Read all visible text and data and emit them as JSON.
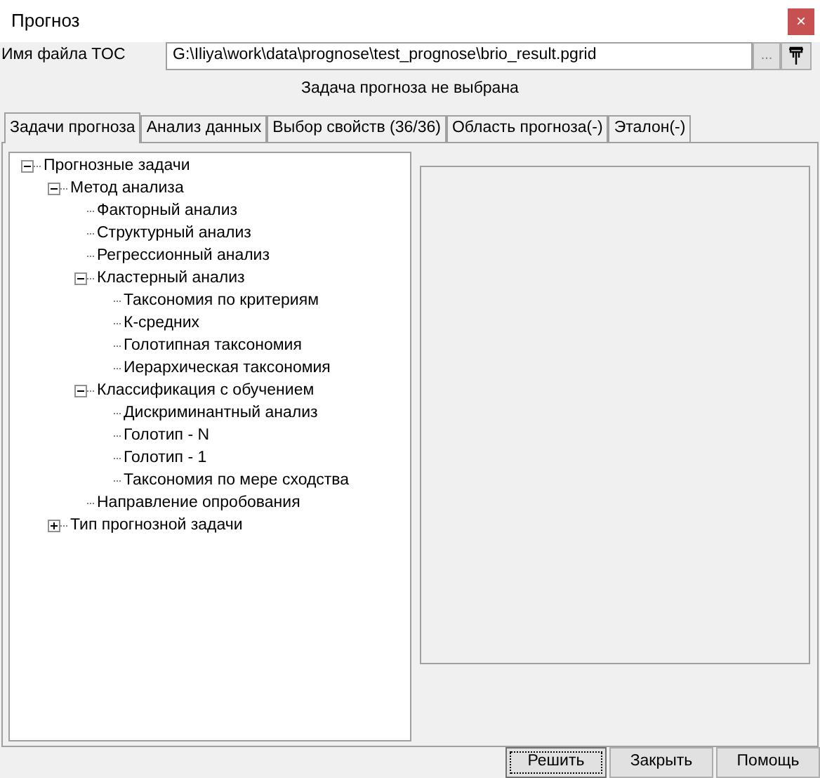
{
  "window": {
    "title": "Прогноз",
    "close": "×"
  },
  "file": {
    "label": "Имя файла TOC",
    "value": "G:\\Iliya\\work\\data\\prognose\\test_prognose\\brio_result.pgrid",
    "browse": "..."
  },
  "status": "Задача прогноза не выбрана",
  "tabs": [
    {
      "label": "Задачи прогноза",
      "selected": true
    },
    {
      "label": "Анализ данных",
      "selected": false
    },
    {
      "label": "Выбор свойств (36/36)",
      "selected": false
    },
    {
      "label": "Область прогноза(-)",
      "selected": false
    },
    {
      "label": "Эталон(-)",
      "selected": false
    }
  ],
  "tree": [
    {
      "label": "Прогнозные задачи",
      "expanded": true,
      "children": [
        {
          "label": "Метод анализа",
          "expanded": true,
          "children": [
            {
              "label": "Факторный анализ"
            },
            {
              "label": "Структурный анализ"
            },
            {
              "label": "Регрессионный анализ"
            },
            {
              "label": "Кластерный анализ",
              "expanded": true,
              "children": [
                {
                  "label": "Таксономия по критериям"
                },
                {
                  "label": "К-средних"
                },
                {
                  "label": "Голотипная таксономия"
                },
                {
                  "label": "Иерархическая таксономия"
                }
              ]
            },
            {
              "label": "Классификация с обучением",
              "expanded": true,
              "children": [
                {
                  "label": "Дискриминантный анализ"
                },
                {
                  "label": "Голотип - N"
                },
                {
                  "label": "Голотип - 1"
                },
                {
                  "label": "Таксономия по мере сходства"
                }
              ]
            },
            {
              "label": "Направление опробования"
            }
          ]
        },
        {
          "label": "Тип прогнозной задачи",
          "expanded": false
        }
      ]
    }
  ],
  "buttons": [
    "Решить",
    "Закрыть",
    "Помощь"
  ]
}
